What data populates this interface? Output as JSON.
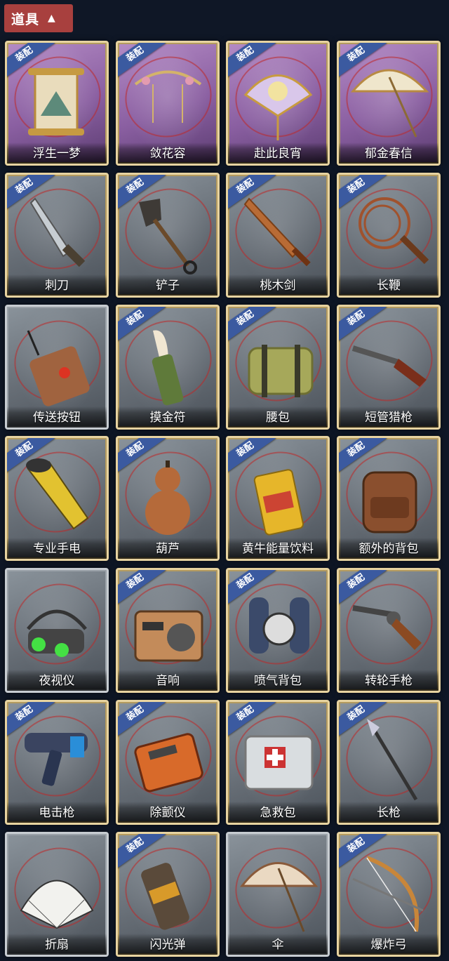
{
  "header": {
    "title": "道具"
  },
  "badge_text": "装配",
  "items": [
    {
      "name": "浮生一梦",
      "equipped": true,
      "style": "purple"
    },
    {
      "name": "敛花容",
      "equipped": true,
      "style": "purple"
    },
    {
      "name": "赴此良宵",
      "equipped": true,
      "style": "purple"
    },
    {
      "name": "郁金春信",
      "equipped": true,
      "style": "purple"
    },
    {
      "name": "刺刀",
      "equipped": true,
      "style": "gold"
    },
    {
      "name": "铲子",
      "equipped": true,
      "style": "gold"
    },
    {
      "name": "桃木剑",
      "equipped": true,
      "style": "gold"
    },
    {
      "name": "长鞭",
      "equipped": true,
      "style": "gold"
    },
    {
      "name": "传送按钮",
      "equipped": false,
      "style": "plain"
    },
    {
      "name": "摸金符",
      "equipped": true,
      "style": "gold"
    },
    {
      "name": "腰包",
      "equipped": true,
      "style": "gold"
    },
    {
      "name": "短管猎枪",
      "equipped": true,
      "style": "gold"
    },
    {
      "name": "专业手电",
      "equipped": true,
      "style": "gold"
    },
    {
      "name": "葫芦",
      "equipped": true,
      "style": "gold"
    },
    {
      "name": "黄牛能量饮料",
      "equipped": true,
      "style": "gold"
    },
    {
      "name": "额外的背包",
      "equipped": true,
      "style": "gold"
    },
    {
      "name": "夜视仪",
      "equipped": false,
      "style": "plain"
    },
    {
      "name": "音响",
      "equipped": true,
      "style": "gold"
    },
    {
      "name": "喷气背包",
      "equipped": true,
      "style": "gold"
    },
    {
      "name": "转轮手枪",
      "equipped": true,
      "style": "gold"
    },
    {
      "name": "电击枪",
      "equipped": true,
      "style": "gold"
    },
    {
      "name": "除颤仪",
      "equipped": true,
      "style": "gold"
    },
    {
      "name": "急救包",
      "equipped": true,
      "style": "gold"
    },
    {
      "name": "长枪",
      "equipped": true,
      "style": "gold"
    },
    {
      "name": "折扇",
      "equipped": false,
      "style": "plain"
    },
    {
      "name": "闪光弹",
      "equipped": true,
      "style": "gold"
    },
    {
      "name": "伞",
      "equipped": false,
      "style": "plain"
    },
    {
      "name": "爆炸弓",
      "equipped": true,
      "style": "gold"
    }
  ]
}
